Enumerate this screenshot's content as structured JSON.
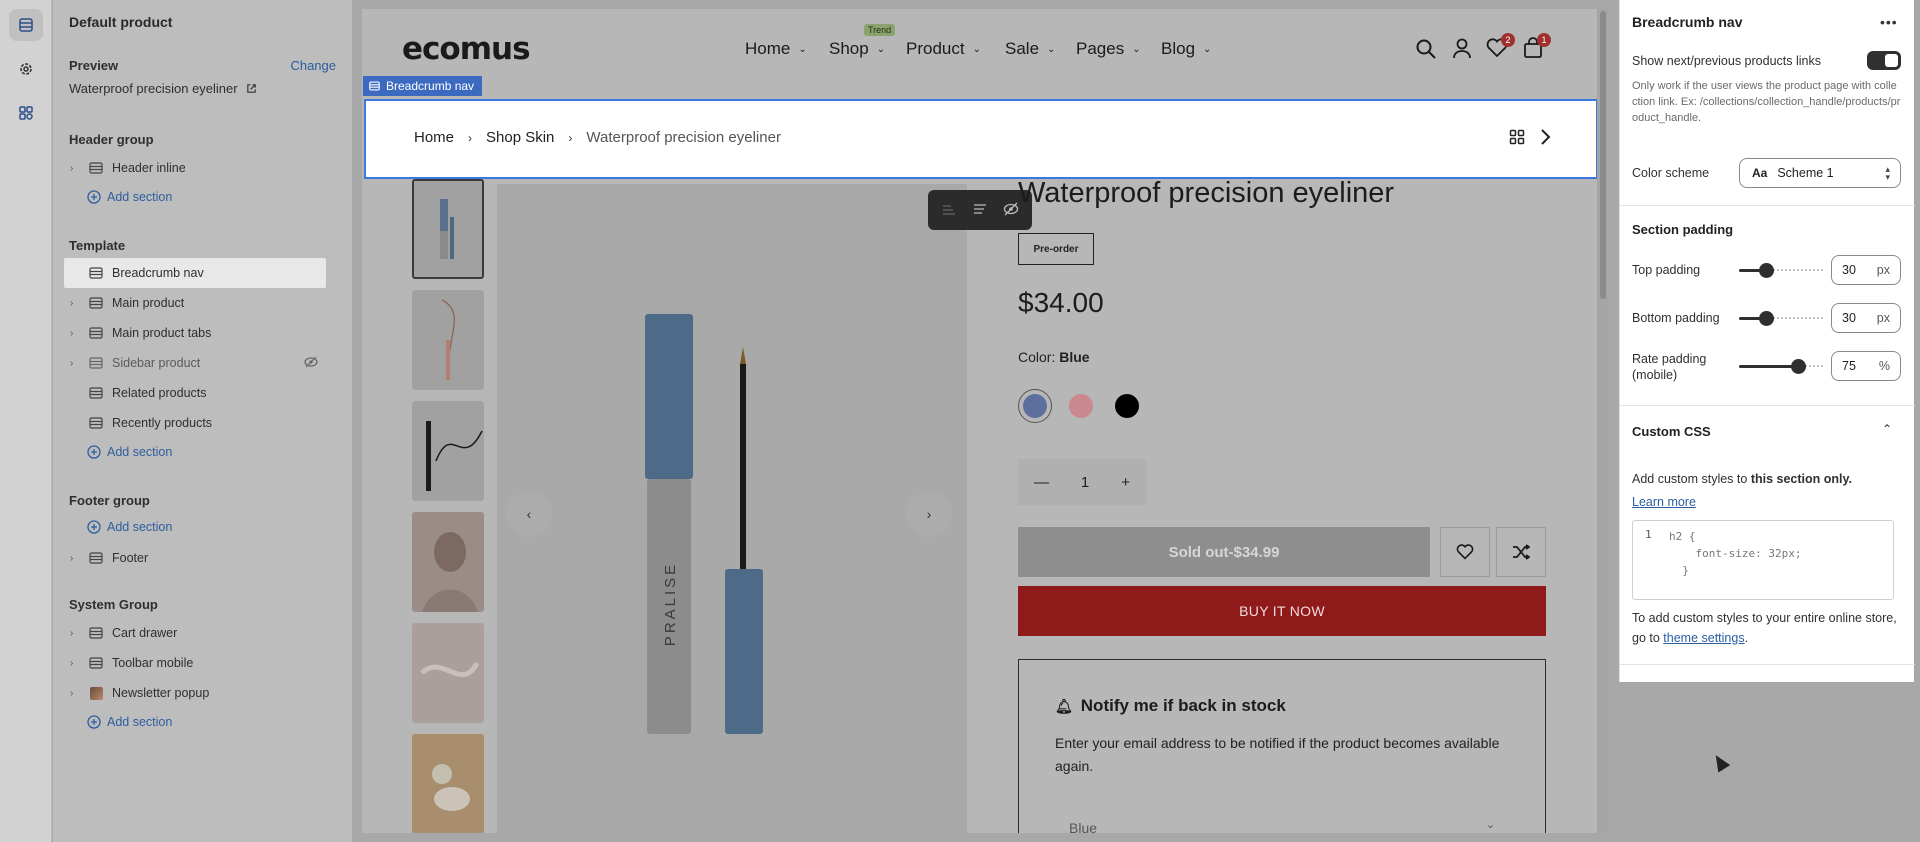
{
  "left_panel": {
    "title": "Default product",
    "preview_label": "Preview",
    "preview_change": "Change",
    "preview_value": "Waterproof precision eyeliner",
    "header_group": {
      "label": "Header group",
      "items": [
        "Header inline"
      ],
      "add": "Add section"
    },
    "template": {
      "label": "Template",
      "items": [
        "Breadcrumb nav",
        "Main product",
        "Main product tabs",
        "Sidebar product",
        "Related products",
        "Recently products"
      ],
      "add": "Add section"
    },
    "footer_group": {
      "label": "Footer group",
      "add": "Add section",
      "items": [
        "Footer"
      ]
    },
    "system_group": {
      "label": "System Group",
      "items": [
        "Cart drawer",
        "Toolbar mobile",
        "Newsletter popup"
      ],
      "add": "Add section"
    }
  },
  "store": {
    "logo": "ecomus",
    "nav": [
      "Home",
      "Shop",
      "Product",
      "Sale",
      "Pages",
      "Blog"
    ],
    "trend_badge": "Trend",
    "wishlist_count": "2",
    "cart_count": "1",
    "section_tag": "Breadcrumb nav",
    "breadcrumb": [
      "Home",
      "Shop Skin",
      "Waterproof precision eyeliner"
    ],
    "product": {
      "title": "Waterproof precision eyeliner",
      "preorder": "Pre-order",
      "price": "$34.00",
      "color_label": "Color:",
      "color_value": "Blue",
      "quantity": "1",
      "sold_out": "Sold out-$34.99",
      "buy_now": "BUY IT NOW",
      "notify_title": "Notify me if back in stock",
      "notify_text": "Enter your email address to be notified if the product becomes available again.",
      "notify_select": "Blue"
    }
  },
  "right_panel": {
    "title": "Breadcrumb nav",
    "show_next_prev": "Show next/previous products links",
    "help": "Only work if the user views the product page with collection link. Ex: /collections/collection_handle/products/product_handle.",
    "color_scheme_label": "Color scheme",
    "color_scheme_value": "Scheme 1",
    "section_padding": "Section padding",
    "top_padding_label": "Top padding",
    "top_padding": "30",
    "bottom_padding_label": "Bottom padding",
    "bottom_padding": "30",
    "rate_padding_label": "Rate padding (mobile)",
    "rate_padding": "75",
    "unit_px": "px",
    "unit_pct": "%",
    "custom_css": "Custom CSS",
    "custom_css_intro_a": "Add custom styles to ",
    "custom_css_intro_b": "this section only.",
    "learn_more": "Learn more",
    "code_line_no": "1",
    "code": "h2 {\n    font-size: 32px;\n  }",
    "note_a": "To add custom styles to your entire online store, go to ",
    "note_link": "theme settings",
    "note_b": "."
  },
  "colors": {
    "accent": "#3b78e0",
    "buy_now": "#8f1a1a",
    "badge": "#a03030"
  }
}
